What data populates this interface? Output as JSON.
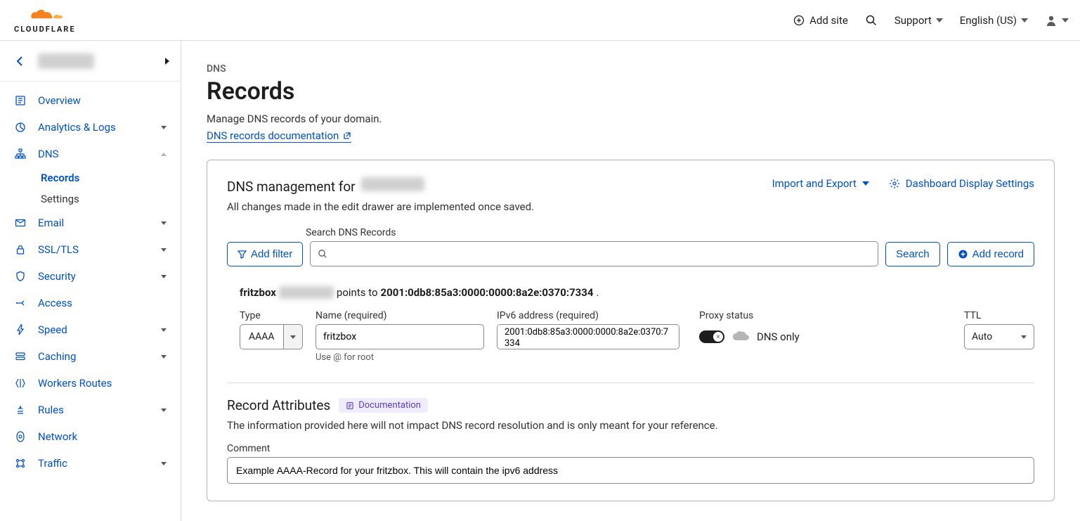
{
  "header": {
    "add_site": "Add site",
    "support": "Support",
    "language": "English (US)"
  },
  "sidebar": {
    "items": [
      {
        "label": "Overview",
        "icon": "overview"
      },
      {
        "label": "Analytics & Logs",
        "icon": "analytics",
        "expandable": true
      },
      {
        "label": "DNS",
        "icon": "dns",
        "expanded": true,
        "children": [
          {
            "label": "Records",
            "active": true
          },
          {
            "label": "Settings"
          }
        ]
      },
      {
        "label": "Email",
        "icon": "email",
        "expandable": true
      },
      {
        "label": "SSL/TLS",
        "icon": "lock",
        "expandable": true
      },
      {
        "label": "Security",
        "icon": "shield",
        "expandable": true
      },
      {
        "label": "Access",
        "icon": "access"
      },
      {
        "label": "Speed",
        "icon": "bolt",
        "expandable": true
      },
      {
        "label": "Caching",
        "icon": "caching",
        "expandable": true
      },
      {
        "label": "Workers Routes",
        "icon": "workers"
      },
      {
        "label": "Rules",
        "icon": "rules",
        "expandable": true
      },
      {
        "label": "Network",
        "icon": "network"
      },
      {
        "label": "Traffic",
        "icon": "traffic",
        "expandable": true
      }
    ]
  },
  "page": {
    "kicker": "DNS",
    "title": "Records",
    "desc": "Manage DNS records of your domain.",
    "doc_link": "DNS records documentation"
  },
  "panel": {
    "title_prefix": "DNS management for",
    "subtitle": "All changes made in the edit drawer are implemented once saved.",
    "import_export": "Import and Export",
    "display_settings": "Dashboard Display Settings",
    "search_label": "Search DNS Records",
    "add_filter": "Add filter",
    "search_btn": "Search",
    "add_record": "Add record"
  },
  "record": {
    "hostname_prefix": "fritzbox",
    "points_to": "points to",
    "ip": "2001:0db8:85a3:0000:0000:8a2e:0370:7334",
    "type_label": "Type",
    "type_value": "AAAA",
    "name_label": "Name (required)",
    "name_value": "fritzbox",
    "name_hint": "Use @ for root",
    "ip_label": "IPv6 address (required)",
    "ip_value": "2001:0db8:85a3:0000:0000:8a2e:0370:7334",
    "proxy_label": "Proxy status",
    "proxy_text": "DNS only",
    "ttl_label": "TTL",
    "ttl_value": "Auto"
  },
  "attributes": {
    "title": "Record Attributes",
    "doc_badge": "Documentation",
    "desc": "The information provided here will not impact DNS record resolution and is only meant for your reference.",
    "comment_label": "Comment",
    "comment_value": "Example AAAA-Record for your fritzbox. This will contain the ipv6 address"
  }
}
